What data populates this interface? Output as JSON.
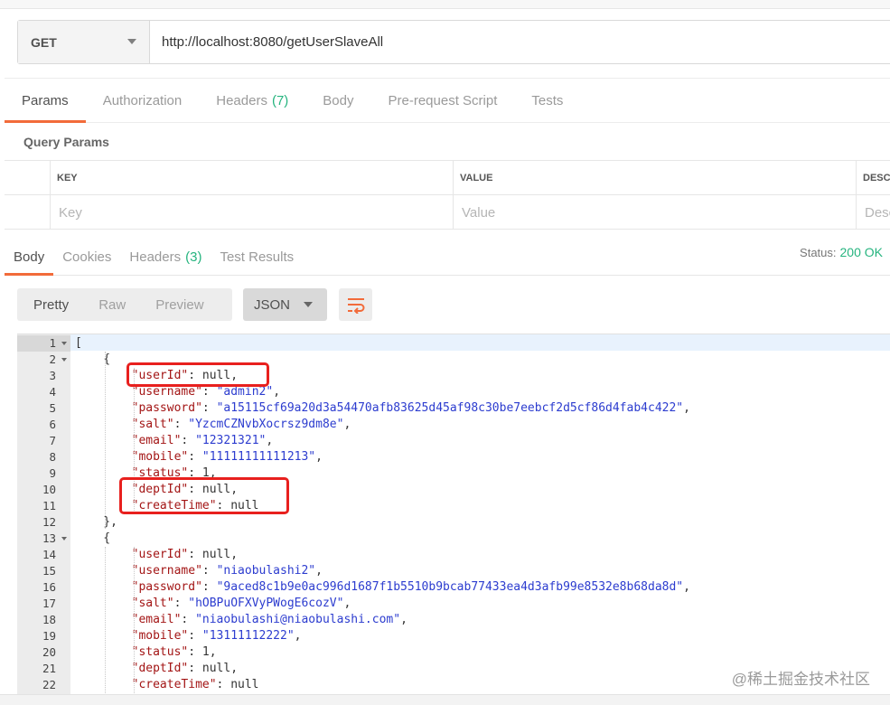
{
  "request": {
    "method": "GET",
    "url": "http://localhost:8080/getUserSlaveAll"
  },
  "request_tabs": [
    {
      "label": "Params",
      "count": ""
    },
    {
      "label": "Authorization",
      "count": ""
    },
    {
      "label": "Headers",
      "count": "(7)"
    },
    {
      "label": "Body",
      "count": ""
    },
    {
      "label": "Pre-request Script",
      "count": ""
    },
    {
      "label": "Tests",
      "count": ""
    }
  ],
  "query_params": {
    "title": "Query Params",
    "headers": {
      "key": "KEY",
      "value": "VALUE",
      "desc": "DESCRIPTION"
    },
    "row": {
      "key_placeholder": "Key",
      "value_placeholder": "Value",
      "desc_placeholder": "Description"
    }
  },
  "response_tabs": [
    {
      "label": "Body",
      "count": ""
    },
    {
      "label": "Cookies",
      "count": ""
    },
    {
      "label": "Headers",
      "count": "(3)"
    },
    {
      "label": "Test Results",
      "count": ""
    }
  ],
  "status": {
    "label": "Status:",
    "value": "200 OK"
  },
  "format_buttons": [
    "Pretty",
    "Raw",
    "Preview"
  ],
  "language": "JSON",
  "code_lines": [
    {
      "n": "1",
      "fold": true,
      "tokens": [
        {
          "t": "p",
          "v": "["
        }
      ]
    },
    {
      "n": "2",
      "fold": true,
      "tokens": [
        {
          "t": "p",
          "v": "    {"
        }
      ]
    },
    {
      "n": "3",
      "fold": false,
      "tokens": [
        {
          "t": "p",
          "v": "        "
        },
        {
          "t": "k",
          "v": "\"userId\""
        },
        {
          "t": "p",
          "v": ": null,"
        }
      ]
    },
    {
      "n": "4",
      "fold": false,
      "tokens": [
        {
          "t": "p",
          "v": "        "
        },
        {
          "t": "k",
          "v": "\"username\""
        },
        {
          "t": "p",
          "v": ": "
        },
        {
          "t": "s",
          "v": "\"admin2\""
        },
        {
          "t": "p",
          "v": ","
        }
      ]
    },
    {
      "n": "5",
      "fold": false,
      "tokens": [
        {
          "t": "p",
          "v": "        "
        },
        {
          "t": "k",
          "v": "\"password\""
        },
        {
          "t": "p",
          "v": ": "
        },
        {
          "t": "s",
          "v": "\"a15115cf69a20d3a54470afb83625d45af98c30be7eebcf2d5cf86d4fab4c422\""
        },
        {
          "t": "p",
          "v": ","
        }
      ]
    },
    {
      "n": "6",
      "fold": false,
      "tokens": [
        {
          "t": "p",
          "v": "        "
        },
        {
          "t": "k",
          "v": "\"salt\""
        },
        {
          "t": "p",
          "v": ": "
        },
        {
          "t": "s",
          "v": "\"YzcmCZNvbXocrsz9dm8e\""
        },
        {
          "t": "p",
          "v": ","
        }
      ]
    },
    {
      "n": "7",
      "fold": false,
      "tokens": [
        {
          "t": "p",
          "v": "        "
        },
        {
          "t": "k",
          "v": "\"email\""
        },
        {
          "t": "p",
          "v": ": "
        },
        {
          "t": "s",
          "v": "\"12321321\""
        },
        {
          "t": "p",
          "v": ","
        }
      ]
    },
    {
      "n": "8",
      "fold": false,
      "tokens": [
        {
          "t": "p",
          "v": "        "
        },
        {
          "t": "k",
          "v": "\"mobile\""
        },
        {
          "t": "p",
          "v": ": "
        },
        {
          "t": "s",
          "v": "\"11111111111213\""
        },
        {
          "t": "p",
          "v": ","
        }
      ]
    },
    {
      "n": "9",
      "fold": false,
      "tokens": [
        {
          "t": "p",
          "v": "        "
        },
        {
          "t": "k",
          "v": "\"status\""
        },
        {
          "t": "p",
          "v": ": 1,"
        }
      ]
    },
    {
      "n": "10",
      "fold": false,
      "tokens": [
        {
          "t": "p",
          "v": "        "
        },
        {
          "t": "k",
          "v": "\"deptId\""
        },
        {
          "t": "p",
          "v": ": null,"
        }
      ]
    },
    {
      "n": "11",
      "fold": false,
      "tokens": [
        {
          "t": "p",
          "v": "        "
        },
        {
          "t": "k",
          "v": "\"createTime\""
        },
        {
          "t": "p",
          "v": ": null"
        }
      ]
    },
    {
      "n": "12",
      "fold": false,
      "tokens": [
        {
          "t": "p",
          "v": "    },"
        }
      ]
    },
    {
      "n": "13",
      "fold": true,
      "tokens": [
        {
          "t": "p",
          "v": "    {"
        }
      ]
    },
    {
      "n": "14",
      "fold": false,
      "tokens": [
        {
          "t": "p",
          "v": "        "
        },
        {
          "t": "k",
          "v": "\"userId\""
        },
        {
          "t": "p",
          "v": ": null,"
        }
      ]
    },
    {
      "n": "15",
      "fold": false,
      "tokens": [
        {
          "t": "p",
          "v": "        "
        },
        {
          "t": "k",
          "v": "\"username\""
        },
        {
          "t": "p",
          "v": ": "
        },
        {
          "t": "s",
          "v": "\"niaobulashi2\""
        },
        {
          "t": "p",
          "v": ","
        }
      ]
    },
    {
      "n": "16",
      "fold": false,
      "tokens": [
        {
          "t": "p",
          "v": "        "
        },
        {
          "t": "k",
          "v": "\"password\""
        },
        {
          "t": "p",
          "v": ": "
        },
        {
          "t": "s",
          "v": "\"9aced8c1b9e0ac996d1687f1b5510b9bcab77433ea4d3afb99e8532e8b68da8d\""
        },
        {
          "t": "p",
          "v": ","
        }
      ]
    },
    {
      "n": "17",
      "fold": false,
      "tokens": [
        {
          "t": "p",
          "v": "        "
        },
        {
          "t": "k",
          "v": "\"salt\""
        },
        {
          "t": "p",
          "v": ": "
        },
        {
          "t": "s",
          "v": "\"hOBPuOFXVyPWogE6cozV\""
        },
        {
          "t": "p",
          "v": ","
        }
      ]
    },
    {
      "n": "18",
      "fold": false,
      "tokens": [
        {
          "t": "p",
          "v": "        "
        },
        {
          "t": "k",
          "v": "\"email\""
        },
        {
          "t": "p",
          "v": ": "
        },
        {
          "t": "s",
          "v": "\"niaobulashi@niaobulashi.com\""
        },
        {
          "t": "p",
          "v": ","
        }
      ]
    },
    {
      "n": "19",
      "fold": false,
      "tokens": [
        {
          "t": "p",
          "v": "        "
        },
        {
          "t": "k",
          "v": "\"mobile\""
        },
        {
          "t": "p",
          "v": ": "
        },
        {
          "t": "s",
          "v": "\"13111112222\""
        },
        {
          "t": "p",
          "v": ","
        }
      ]
    },
    {
      "n": "20",
      "fold": false,
      "tokens": [
        {
          "t": "p",
          "v": "        "
        },
        {
          "t": "k",
          "v": "\"status\""
        },
        {
          "t": "p",
          "v": ": 1,"
        }
      ]
    },
    {
      "n": "21",
      "fold": false,
      "tokens": [
        {
          "t": "p",
          "v": "        "
        },
        {
          "t": "k",
          "v": "\"deptId\""
        },
        {
          "t": "p",
          "v": ": null,"
        }
      ]
    },
    {
      "n": "22",
      "fold": false,
      "tokens": [
        {
          "t": "p",
          "v": "        "
        },
        {
          "t": "k",
          "v": "\"createTime\""
        },
        {
          "t": "p",
          "v": ": null"
        }
      ]
    }
  ],
  "watermark": "@稀土掘金技术社区",
  "colors": {
    "accent": "#f26b3a",
    "success": "#26b47f",
    "highlight": "#e8201e",
    "json_key": "#a31515",
    "json_string": "#2c3ccf"
  }
}
